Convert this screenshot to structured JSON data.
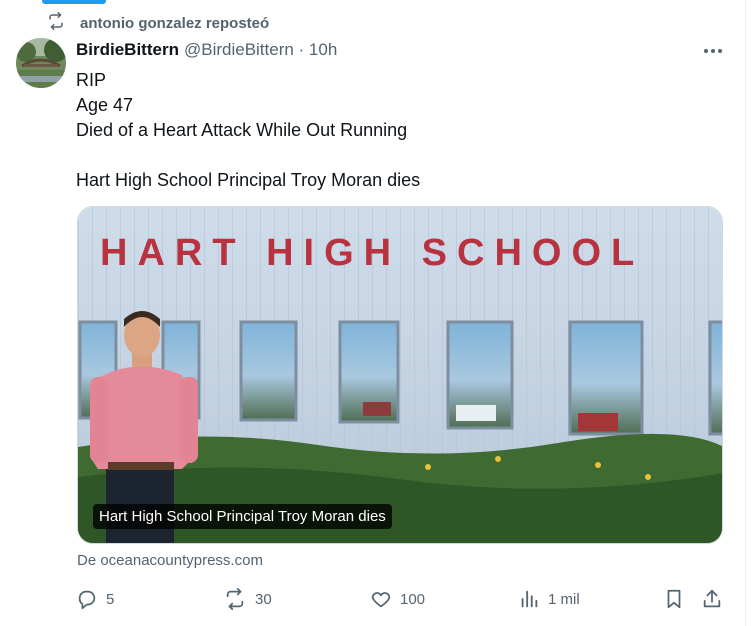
{
  "repost": {
    "label": "antonio gonzalez reposteó",
    "icon": "repost-icon"
  },
  "tweet": {
    "author_name": "BirdieBittern",
    "handle_time": "@BirdieBittern · 10h",
    "lines": [
      "RIP",
      "Age 47",
      "Died of a Heart Attack While Out Running",
      "",
      "Hart High School Principal Troy Moran dies"
    ],
    "media": {
      "sign_text": "HART HIGH SCHOOL",
      "caption": "Hart High School Principal Troy Moran dies"
    },
    "source": "De oceanacountypress.com"
  },
  "actions": {
    "replies": "5",
    "reposts": "30",
    "likes": "100",
    "views": "1 mil"
  },
  "colors": {
    "accent": "#1d9bf0",
    "muted": "#536471",
    "text": "#0f1419"
  }
}
